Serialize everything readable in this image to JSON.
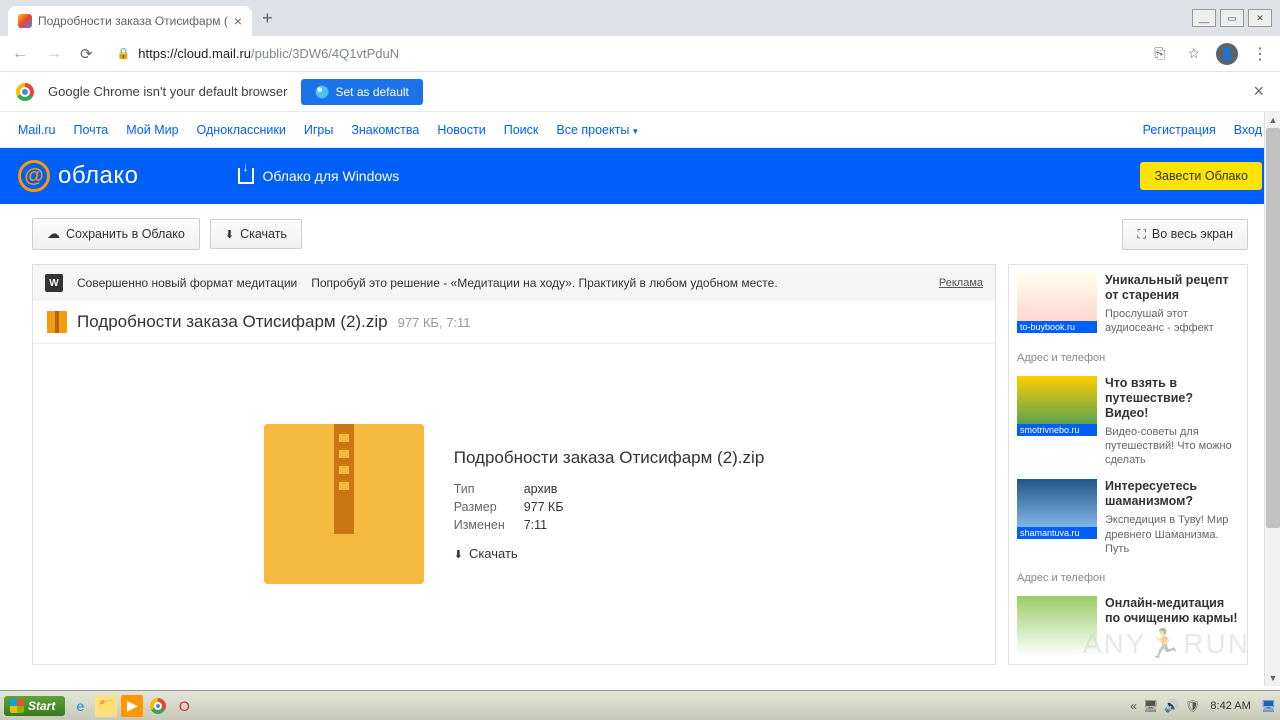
{
  "browser": {
    "tab_title": "Подробности заказа Отисифарм (",
    "url_host": "https://cloud.mail.ru",
    "url_path": "/public/3DW6/4Q1vtPduN"
  },
  "infobar": {
    "message": "Google Chrome isn't your default browser",
    "button": "Set as default"
  },
  "mailru_nav": {
    "items": [
      "Mail.ru",
      "Почта",
      "Мой Мир",
      "Одноклассники",
      "Игры",
      "Знакомства",
      "Новости",
      "Поиск",
      "Все проекты"
    ],
    "register": "Регистрация",
    "login": "Вход"
  },
  "cloud": {
    "logo_text": "облако",
    "windows_link": "Облако для Windows",
    "cta": "Завести Облако"
  },
  "actions": {
    "save": "Сохранить в Облако",
    "download": "Скачать",
    "fullscreen": "Во весь экран"
  },
  "ad_strip": {
    "badge": "W",
    "text1": "Совершенно новый формат медитации",
    "text2": "Попробуй это решение - «Медитации на ходу». Практикуй в любом удобном месте.",
    "label": "Реклама"
  },
  "file": {
    "name": "Подробности заказа Отисифарм (2).zip",
    "size_time": "977 КБ, 7:11",
    "type_label": "Тип",
    "type_value": "архив",
    "size_label": "Размер",
    "size_value": "977 КБ",
    "modified_label": "Изменен",
    "modified_value": "7:11",
    "download": "Скачать"
  },
  "side_ads": [
    {
      "cap": "to-buybook.ru",
      "title": "Уникальный рецепт от старения",
      "desc": "Прослушай этот аудиосеанс - эффект",
      "addr": "Адрес и телефон"
    },
    {
      "cap": "smotrivnebo.ru",
      "title": "Что взять в путешествие? Видео!",
      "desc": "Видео-советы для путешествий! Что можно сделать",
      "addr": ""
    },
    {
      "cap": "shamantuva.ru",
      "title": "Интересуетесь шаманизмом?",
      "desc": "Экспедиция в Туву! Мир древнего Шаманизма. Путь",
      "addr": "Адрес и телефон"
    },
    {
      "cap": "",
      "title": "Онлайн-медитация по очищению кармы!",
      "desc": "",
      "addr": ""
    }
  ],
  "taskbar": {
    "start": "Start",
    "clock": "8:42 AM"
  },
  "watermark": "ANY🏃RUN"
}
